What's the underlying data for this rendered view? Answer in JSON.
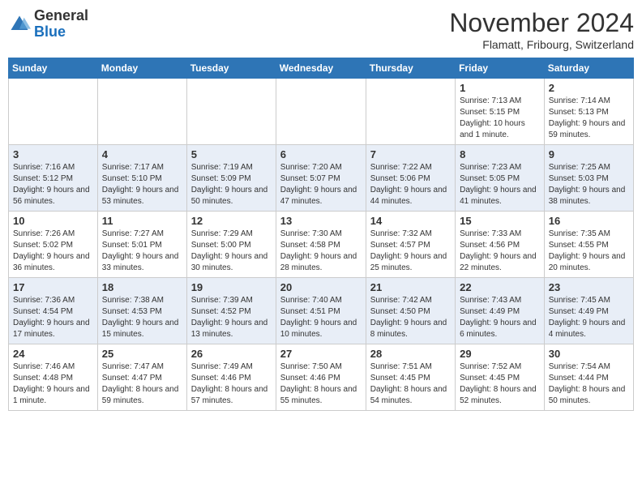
{
  "header": {
    "logo_general": "General",
    "logo_blue": "Blue",
    "month": "November 2024",
    "location": "Flamatt, Fribourg, Switzerland"
  },
  "weekdays": [
    "Sunday",
    "Monday",
    "Tuesday",
    "Wednesday",
    "Thursday",
    "Friday",
    "Saturday"
  ],
  "weeks": [
    [
      {
        "day": "",
        "info": ""
      },
      {
        "day": "",
        "info": ""
      },
      {
        "day": "",
        "info": ""
      },
      {
        "day": "",
        "info": ""
      },
      {
        "day": "",
        "info": ""
      },
      {
        "day": "1",
        "info": "Sunrise: 7:13 AM\nSunset: 5:15 PM\nDaylight: 10 hours and 1 minute."
      },
      {
        "day": "2",
        "info": "Sunrise: 7:14 AM\nSunset: 5:13 PM\nDaylight: 9 hours and 59 minutes."
      }
    ],
    [
      {
        "day": "3",
        "info": "Sunrise: 7:16 AM\nSunset: 5:12 PM\nDaylight: 9 hours and 56 minutes."
      },
      {
        "day": "4",
        "info": "Sunrise: 7:17 AM\nSunset: 5:10 PM\nDaylight: 9 hours and 53 minutes."
      },
      {
        "day": "5",
        "info": "Sunrise: 7:19 AM\nSunset: 5:09 PM\nDaylight: 9 hours and 50 minutes."
      },
      {
        "day": "6",
        "info": "Sunrise: 7:20 AM\nSunset: 5:07 PM\nDaylight: 9 hours and 47 minutes."
      },
      {
        "day": "7",
        "info": "Sunrise: 7:22 AM\nSunset: 5:06 PM\nDaylight: 9 hours and 44 minutes."
      },
      {
        "day": "8",
        "info": "Sunrise: 7:23 AM\nSunset: 5:05 PM\nDaylight: 9 hours and 41 minutes."
      },
      {
        "day": "9",
        "info": "Sunrise: 7:25 AM\nSunset: 5:03 PM\nDaylight: 9 hours and 38 minutes."
      }
    ],
    [
      {
        "day": "10",
        "info": "Sunrise: 7:26 AM\nSunset: 5:02 PM\nDaylight: 9 hours and 36 minutes."
      },
      {
        "day": "11",
        "info": "Sunrise: 7:27 AM\nSunset: 5:01 PM\nDaylight: 9 hours and 33 minutes."
      },
      {
        "day": "12",
        "info": "Sunrise: 7:29 AM\nSunset: 5:00 PM\nDaylight: 9 hours and 30 minutes."
      },
      {
        "day": "13",
        "info": "Sunrise: 7:30 AM\nSunset: 4:58 PM\nDaylight: 9 hours and 28 minutes."
      },
      {
        "day": "14",
        "info": "Sunrise: 7:32 AM\nSunset: 4:57 PM\nDaylight: 9 hours and 25 minutes."
      },
      {
        "day": "15",
        "info": "Sunrise: 7:33 AM\nSunset: 4:56 PM\nDaylight: 9 hours and 22 minutes."
      },
      {
        "day": "16",
        "info": "Sunrise: 7:35 AM\nSunset: 4:55 PM\nDaylight: 9 hours and 20 minutes."
      }
    ],
    [
      {
        "day": "17",
        "info": "Sunrise: 7:36 AM\nSunset: 4:54 PM\nDaylight: 9 hours and 17 minutes."
      },
      {
        "day": "18",
        "info": "Sunrise: 7:38 AM\nSunset: 4:53 PM\nDaylight: 9 hours and 15 minutes."
      },
      {
        "day": "19",
        "info": "Sunrise: 7:39 AM\nSunset: 4:52 PM\nDaylight: 9 hours and 13 minutes."
      },
      {
        "day": "20",
        "info": "Sunrise: 7:40 AM\nSunset: 4:51 PM\nDaylight: 9 hours and 10 minutes."
      },
      {
        "day": "21",
        "info": "Sunrise: 7:42 AM\nSunset: 4:50 PM\nDaylight: 9 hours and 8 minutes."
      },
      {
        "day": "22",
        "info": "Sunrise: 7:43 AM\nSunset: 4:49 PM\nDaylight: 9 hours and 6 minutes."
      },
      {
        "day": "23",
        "info": "Sunrise: 7:45 AM\nSunset: 4:49 PM\nDaylight: 9 hours and 4 minutes."
      }
    ],
    [
      {
        "day": "24",
        "info": "Sunrise: 7:46 AM\nSunset: 4:48 PM\nDaylight: 9 hours and 1 minute."
      },
      {
        "day": "25",
        "info": "Sunrise: 7:47 AM\nSunset: 4:47 PM\nDaylight: 8 hours and 59 minutes."
      },
      {
        "day": "26",
        "info": "Sunrise: 7:49 AM\nSunset: 4:46 PM\nDaylight: 8 hours and 57 minutes."
      },
      {
        "day": "27",
        "info": "Sunrise: 7:50 AM\nSunset: 4:46 PM\nDaylight: 8 hours and 55 minutes."
      },
      {
        "day": "28",
        "info": "Sunrise: 7:51 AM\nSunset: 4:45 PM\nDaylight: 8 hours and 54 minutes."
      },
      {
        "day": "29",
        "info": "Sunrise: 7:52 AM\nSunset: 4:45 PM\nDaylight: 8 hours and 52 minutes."
      },
      {
        "day": "30",
        "info": "Sunrise: 7:54 AM\nSunset: 4:44 PM\nDaylight: 8 hours and 50 minutes."
      }
    ]
  ]
}
